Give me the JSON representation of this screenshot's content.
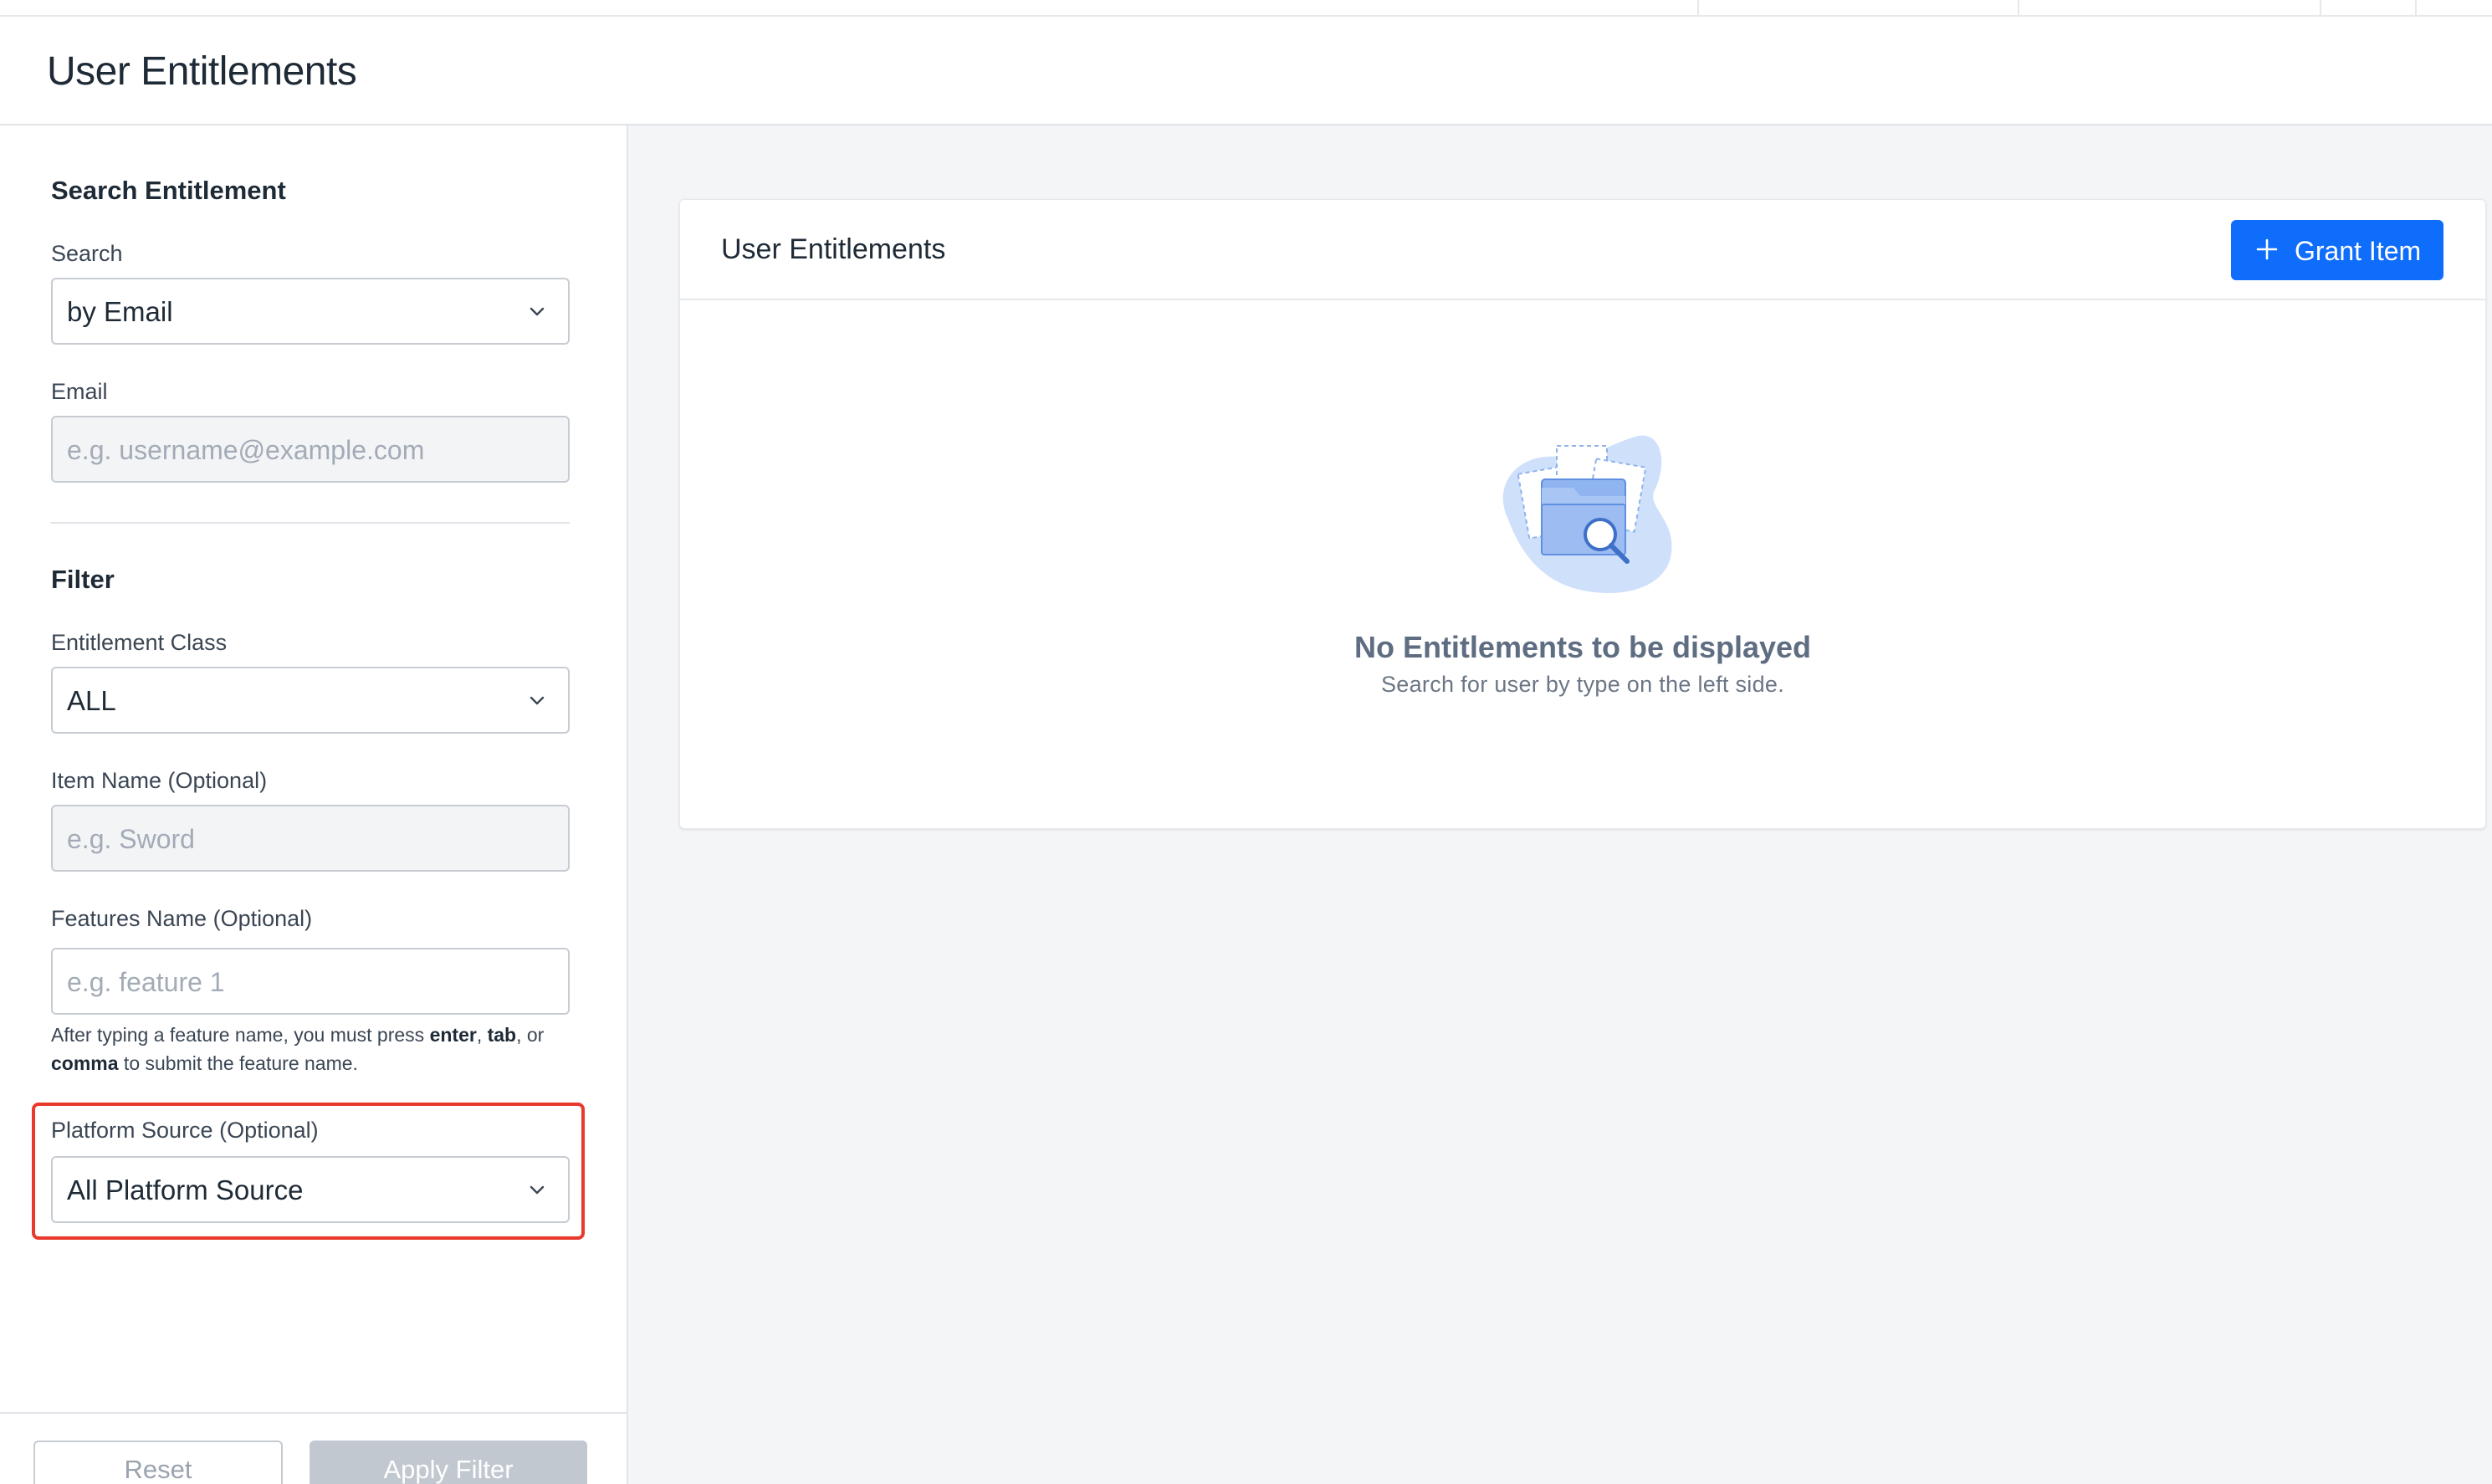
{
  "page": {
    "title": "User Entitlements"
  },
  "sidebar": {
    "search_section": {
      "title": "Search Entitlement",
      "search_label": "Search",
      "search_value": "by Email",
      "email_label": "Email",
      "email_placeholder": "e.g. username@example.com"
    },
    "filter_section": {
      "title": "Filter",
      "class_label": "Entitlement Class",
      "class_value": "ALL",
      "item_label": "Item Name (Optional)",
      "item_placeholder": "e.g. Sword",
      "features_label": "Features Name (Optional)",
      "features_placeholder": "e.g. feature 1",
      "helper_prefix": "After typing a feature name, you must press ",
      "helper_enter": "enter",
      "helper_sep1": ", ",
      "helper_tab": "tab",
      "helper_sep2": ", or ",
      "helper_comma": "comma",
      "helper_suffix": " to submit the feature name.",
      "platform_label": "Platform Source (Optional)",
      "platform_value": "All Platform Source"
    },
    "footer": {
      "reset_label": "Reset",
      "apply_label": "Apply Filter"
    }
  },
  "main": {
    "card": {
      "title": "User Entitlements",
      "grant_label": "Grant Item",
      "empty_title": "No Entitlements to be displayed",
      "empty_subtitle": "Search for user by type on the left side."
    }
  },
  "colors": {
    "primary": "#0f6dfb",
    "highlight": "#e8392c",
    "disabled_button": "#c2c8d0",
    "main_background": "#f4f5f7"
  },
  "icons": [
    "chevron-down-icon",
    "plus-icon",
    "empty-folder-search-illustration"
  ]
}
